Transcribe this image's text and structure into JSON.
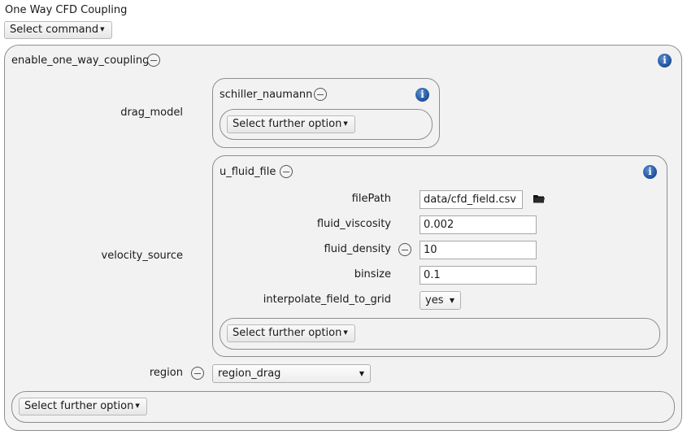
{
  "window": {
    "title": "One Way CFD Coupling"
  },
  "command": {
    "label": "Select command",
    "caret": "▾"
  },
  "main_group": {
    "label": "enable_one_way_coupling",
    "info_icon": "i",
    "further_option": "Select further option"
  },
  "drag_model": {
    "label": "drag_model",
    "group_label": "schiller_naumann",
    "further_option": "Select further option"
  },
  "velocity_source": {
    "label": "velocity_source",
    "group_label": "u_fluid_file",
    "filePath": {
      "label": "filePath",
      "value": "data/cfd_field.csv"
    },
    "fluid_viscosity": {
      "label": "fluid_viscosity",
      "value": "0.002"
    },
    "fluid_density": {
      "label": "fluid_density",
      "value": "10"
    },
    "binsize": {
      "label": "binsize",
      "value": "0.1"
    },
    "interpolate": {
      "label": "interpolate_field_to_grid",
      "value": "yes"
    },
    "further_option": "Select further option"
  },
  "region": {
    "label": "region",
    "value": "region_drag"
  },
  "colors": {
    "info_blue": "#1b4f98",
    "group_bg": "#f2f2f2",
    "border": "#8e8e8e"
  }
}
